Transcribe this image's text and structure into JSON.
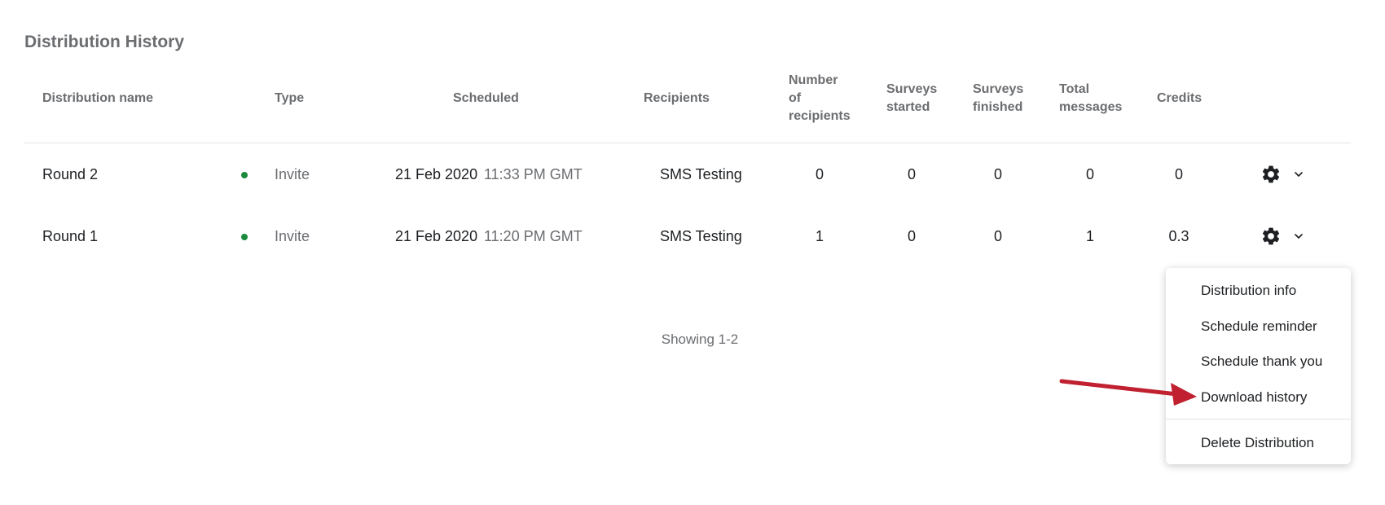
{
  "section": {
    "title": "Distribution History"
  },
  "columns": {
    "name": "Distribution name",
    "type": "Type",
    "scheduled": "Scheduled",
    "recipients": "Recipients",
    "num_recipients_1": "Number",
    "num_recipients_2": "of",
    "num_recipients_3": "recipients",
    "surveys_started_1": "Surveys",
    "surveys_started_2": "started",
    "surveys_finished_1": "Surveys",
    "surveys_finished_2": "finished",
    "total_messages_1": "Total",
    "total_messages_2": "messages",
    "credits": "Credits"
  },
  "rows": [
    {
      "name": "Round 2",
      "status_color": "#1a8a3c",
      "type": "Invite",
      "date": "21 Feb 2020",
      "time": "11:33 PM GMT",
      "recipients": "SMS Testing",
      "num_recipients": "0",
      "surveys_started": "0",
      "surveys_finished": "0",
      "total_messages": "0",
      "credits": "0"
    },
    {
      "name": "Round 1",
      "status_color": "#1a8a3c",
      "type": "Invite",
      "date": "21 Feb 2020",
      "time": "11:20 PM GMT",
      "recipients": "SMS Testing",
      "num_recipients": "1",
      "surveys_started": "0",
      "surveys_finished": "0",
      "total_messages": "1",
      "credits": "0.3"
    }
  ],
  "pagination": {
    "text": "Showing 1-2"
  },
  "menu": {
    "items": [
      "Distribution info",
      "Schedule reminder",
      "Schedule thank you",
      "Download history",
      "Delete Distribution"
    ]
  },
  "icons": {
    "row_actions": "gear-icon",
    "row_expand": "chevron-down-icon",
    "callout": "arrow-icon"
  },
  "colors": {
    "status_active": "#1a8a3c",
    "callout_arrow": "#c0202f"
  }
}
